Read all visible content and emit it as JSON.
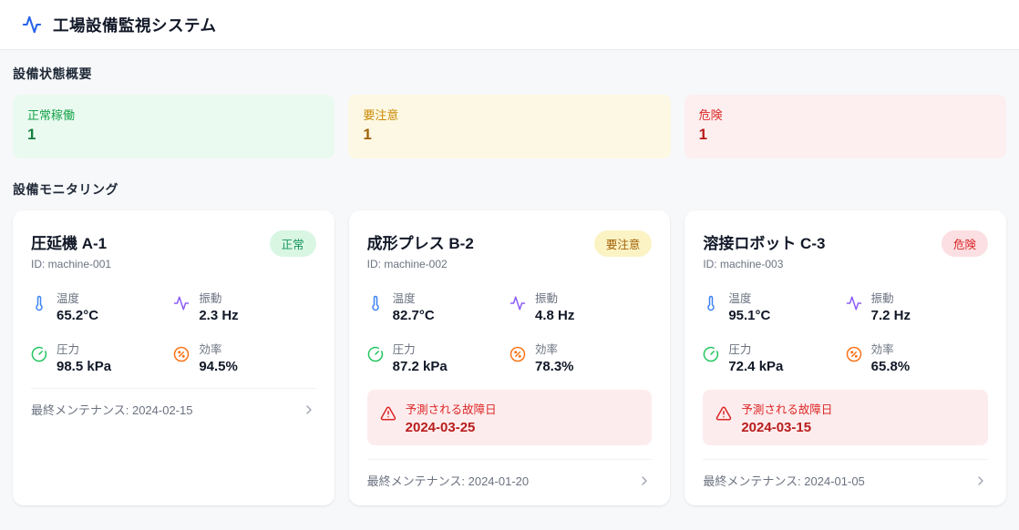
{
  "header": {
    "title": "工場設備監視システム"
  },
  "overview": {
    "title": "設備状態概要",
    "cards": [
      {
        "label": "正常稼働",
        "value": "1"
      },
      {
        "label": "要注意",
        "value": "1"
      },
      {
        "label": "危険",
        "value": "1"
      }
    ]
  },
  "monitoring": {
    "title": "設備モニタリング",
    "metric_labels": {
      "temperature": "温度",
      "vibration": "振動",
      "pressure": "圧力",
      "efficiency": "効率"
    },
    "failure_label": "予測される故障日",
    "machines": [
      {
        "name": "圧延機 A-1",
        "id": "ID: machine-001",
        "status": "正常",
        "temperature": "65.2°C",
        "vibration": "2.3 Hz",
        "pressure": "98.5 kPa",
        "efficiency": "94.5%",
        "maintenance": "最終メンテナンス: 2024-02-15"
      },
      {
        "name": "成形プレス B-2",
        "id": "ID: machine-002",
        "status": "要注意",
        "temperature": "82.7°C",
        "vibration": "4.8 Hz",
        "pressure": "87.2 kPa",
        "efficiency": "78.3%",
        "failure_date": "2024-03-25",
        "maintenance": "最終メンテナンス: 2024-01-20"
      },
      {
        "name": "溶接ロボット C-3",
        "id": "ID: machine-003",
        "status": "危険",
        "temperature": "95.1°C",
        "vibration": "7.2 Hz",
        "pressure": "72.4 kPa",
        "efficiency": "65.8%",
        "failure_date": "2024-03-15",
        "maintenance": "最終メンテナンス: 2024-01-05"
      }
    ]
  },
  "colors": {
    "accent_blue": "#2563eb",
    "status_normal": "#16a34a",
    "status_caution": "#ca8a04",
    "status_danger": "#dc2626",
    "icon_temperature": "#3b82f6",
    "icon_vibration": "#8b5cf6",
    "icon_pressure": "#22c55e",
    "icon_efficiency": "#f97316",
    "warning_bg": "#fdeced",
    "page_bg": "#f7f8fa"
  }
}
